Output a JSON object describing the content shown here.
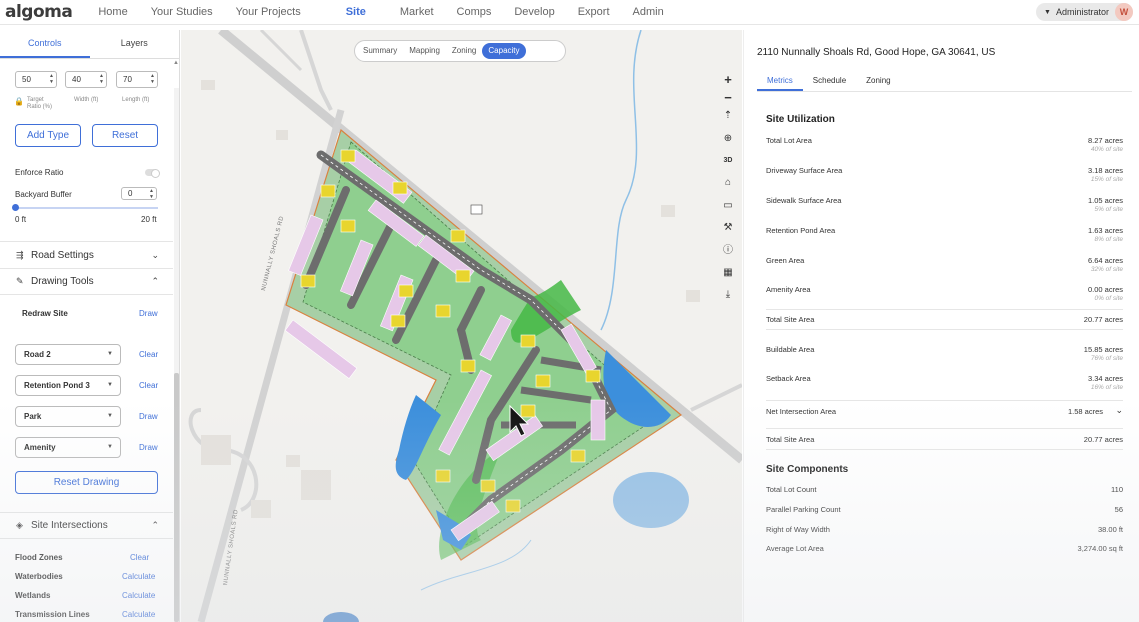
{
  "app": {
    "logo": "algoma",
    "nav": [
      "Home",
      "Your Studies",
      "Your Projects",
      "Site",
      "Market",
      "Comps",
      "Develop",
      "Export",
      "Admin"
    ],
    "active_nav": "Site",
    "user": {
      "role": "Administrator",
      "initial": "W"
    }
  },
  "sidebar": {
    "tabs": [
      "Controls",
      "Layers"
    ],
    "ratio_inputs": {
      "target": "50",
      "width": "40",
      "length": "70",
      "target_label_1": "Target",
      "target_label_2": "Ratio (%)",
      "width_label": "Width (ft)",
      "length_label": "Length (ft)"
    },
    "add_type": "Add Type",
    "reset": "Reset",
    "enforce_ratio": "Enforce Ratio",
    "backyard_buffer": {
      "label": "Backyard Buffer",
      "value": "0",
      "min_label": "0 ft",
      "max_label": "20 ft",
      "level_fraction": 0
    },
    "road_settings": "Road Settings",
    "drawing_tools": "Drawing Tools",
    "redraw_site": {
      "label": "Redraw Site",
      "action": "Draw"
    },
    "drawing_rows": [
      {
        "label": "Road 2",
        "action": "Clear"
      },
      {
        "label": "Retention Pond 3",
        "action": "Clear"
      },
      {
        "label": "Park",
        "action": "Draw"
      },
      {
        "label": "Amenity",
        "action": "Draw"
      }
    ],
    "reset_drawing": "Reset Drawing",
    "site_intersections": "Site Intersections",
    "intersections": [
      {
        "label": "Flood Zones",
        "action": "Clear"
      },
      {
        "label": "Waterbodies",
        "action": "Calculate"
      },
      {
        "label": "Wetlands",
        "action": "Calculate"
      },
      {
        "label": "Transmission Lines",
        "action": "Calculate"
      }
    ]
  },
  "map": {
    "tabs": [
      "Summary",
      "Mapping",
      "Zoning",
      "Capacity"
    ],
    "active_tab": "Capacity",
    "road_label_1": "NUNNALLY SHOALS RD",
    "road_label_2": "NUNNALLY SHOALS RD",
    "controls": {
      "zoom_in": "+",
      "zoom_out": "−",
      "three_d": "3D"
    }
  },
  "panel": {
    "address": "2110 Nunnally Shoals Rd, Good Hope, GA 30641, US",
    "tabs": [
      "Metrics",
      "Schedule",
      "Zoning"
    ],
    "active_tab": "Metrics",
    "site_utilization_title": "Site Utilization",
    "utilization": [
      {
        "label": "Total Lot Area",
        "value": "8.27 acres",
        "sub": "40% of site"
      },
      {
        "label": "Driveway Surface Area",
        "value": "3.18 acres",
        "sub": "15% of site"
      },
      {
        "label": "Sidewalk Surface Area",
        "value": "1.05 acres",
        "sub": "5% of site"
      },
      {
        "label": "Retention Pond Area",
        "value": "1.63 acres",
        "sub": "8% of site"
      },
      {
        "label": "Green Area",
        "value": "6.64 acres",
        "sub": "32% of site"
      },
      {
        "label": "Amenity Area",
        "value": "0.00 acres",
        "sub": "0% of site"
      }
    ],
    "total_site_area_1": {
      "label": "Total Site Area",
      "value": "20.77 acres"
    },
    "buildable": [
      {
        "label": "Buildable Area",
        "value": "15.85 acres",
        "sub": "76% of site"
      },
      {
        "label": "Setback Area",
        "value": "3.34 acres",
        "sub": "16% of site"
      }
    ],
    "net_intersection": {
      "label": "Net Intersection Area",
      "value": "1.58 acres"
    },
    "total_site_area_2": {
      "label": "Total Site Area",
      "value": "20.77 acres"
    },
    "site_components_title": "Site Components",
    "components": [
      {
        "label": "Total Lot Count",
        "value": "110"
      },
      {
        "label": "Parallel Parking Count",
        "value": "56"
      },
      {
        "label": "Right of Way Width",
        "value": "38.00 ft"
      },
      {
        "label": "Average Lot Area",
        "value": "3,274.00 sq ft"
      }
    ]
  }
}
